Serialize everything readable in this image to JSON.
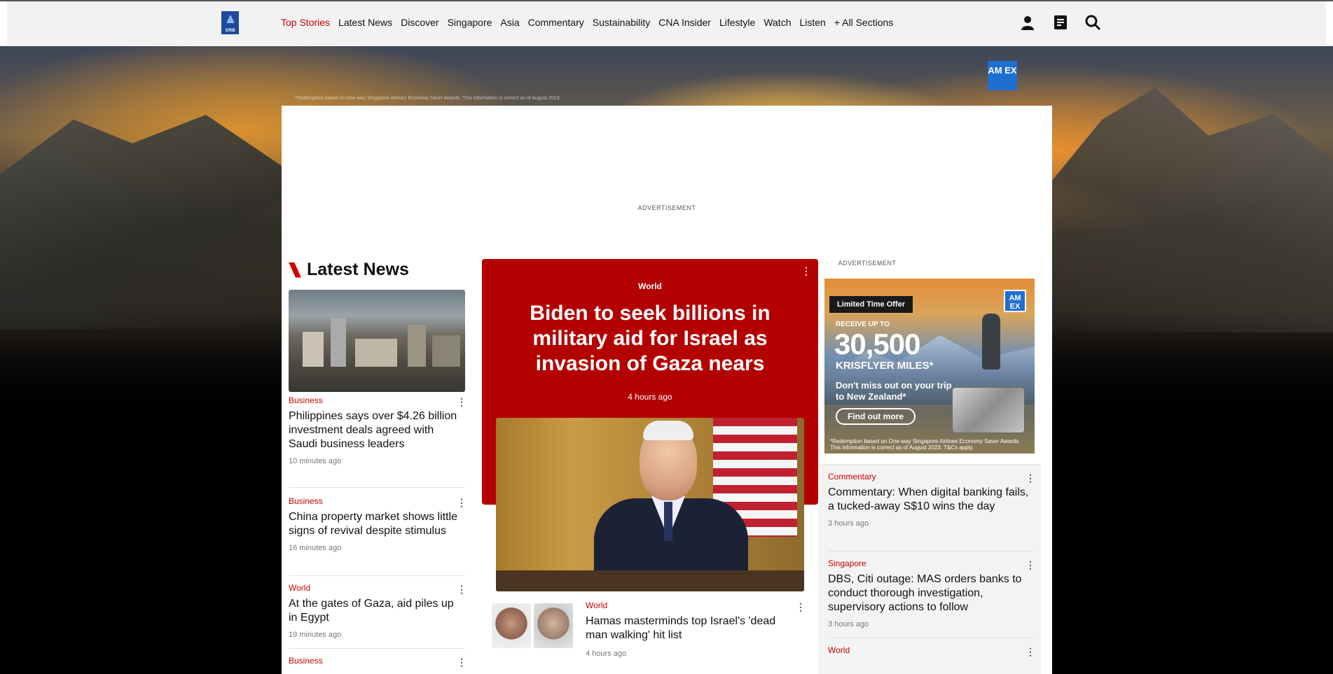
{
  "header": {
    "nav": [
      {
        "label": "Top Stories",
        "active": true
      },
      {
        "label": "Latest News"
      },
      {
        "label": "Discover"
      },
      {
        "label": "Singapore"
      },
      {
        "label": "Asia"
      },
      {
        "label": "Commentary"
      },
      {
        "label": "Sustainability"
      },
      {
        "label": "CNA Insider"
      },
      {
        "label": "Lifestyle"
      },
      {
        "label": "Watch"
      },
      {
        "label": "Listen"
      },
      {
        "label": "+ All Sections"
      }
    ],
    "icons": [
      "user-icon",
      "document-icon",
      "search-icon"
    ]
  },
  "background": {
    "fineprint": "*Redemption based on One-way Singapore Airlines Economy Saver Awards. This information is correct as of August 2023.",
    "amex_logo": "AM EX"
  },
  "ad_top_label": "ADVERTISEMENT",
  "latest": {
    "title": "Latest News",
    "items": [
      {
        "category": "Business",
        "headline": "Philippines says over $4.26 billion investment deals agreed with Saudi business leaders",
        "time": "10 minutes ago"
      },
      {
        "category": "Business",
        "headline": "China property market shows little signs of revival despite stimulus",
        "time": "16 minutes ago"
      },
      {
        "category": "World",
        "headline": "At the gates of Gaza, aid piles up in Egypt",
        "time": "19 minutes ago"
      },
      {
        "category": "Business",
        "headline": "",
        "time": ""
      }
    ]
  },
  "hero": {
    "category": "World",
    "headline": "Biden to seek billions in military aid for Israel as invasion of Gaza nears",
    "time": "4 hours ago"
  },
  "sub_story": {
    "category": "World",
    "headline": "Hamas masterminds top Israel's 'dead man walking' hit list",
    "time": "4 hours ago"
  },
  "ad_right": {
    "label": "ADVERTISEMENT",
    "offer": "Limited Time Offer",
    "amex": "AM EX",
    "receive": "RECEIVE UP TO",
    "amount": "30,500",
    "miles": "KRISFLYER MILES*",
    "copy": "Don't miss out on your trip to New Zealand*",
    "cta": "Find out more",
    "fine": "*Redemption based on One-way Singapore Airlines Economy Saver Awards. This information is correct as of August 2023. T&Cs apply."
  },
  "right_list": [
    {
      "category": "Commentary",
      "headline": "Commentary: When digital banking fails, a tucked-away S$10 wins the day",
      "time": "3 hours ago"
    },
    {
      "category": "Singapore",
      "headline": "DBS, Citi outage: MAS orders banks to conduct thorough investigation, supervisory actions to follow",
      "time": "3 hours ago"
    },
    {
      "category": "World",
      "headline": "",
      "time": ""
    }
  ],
  "colors": {
    "accent": "#c00000",
    "hero_bg": "#b30000",
    "logo": "#1d4a9e"
  }
}
